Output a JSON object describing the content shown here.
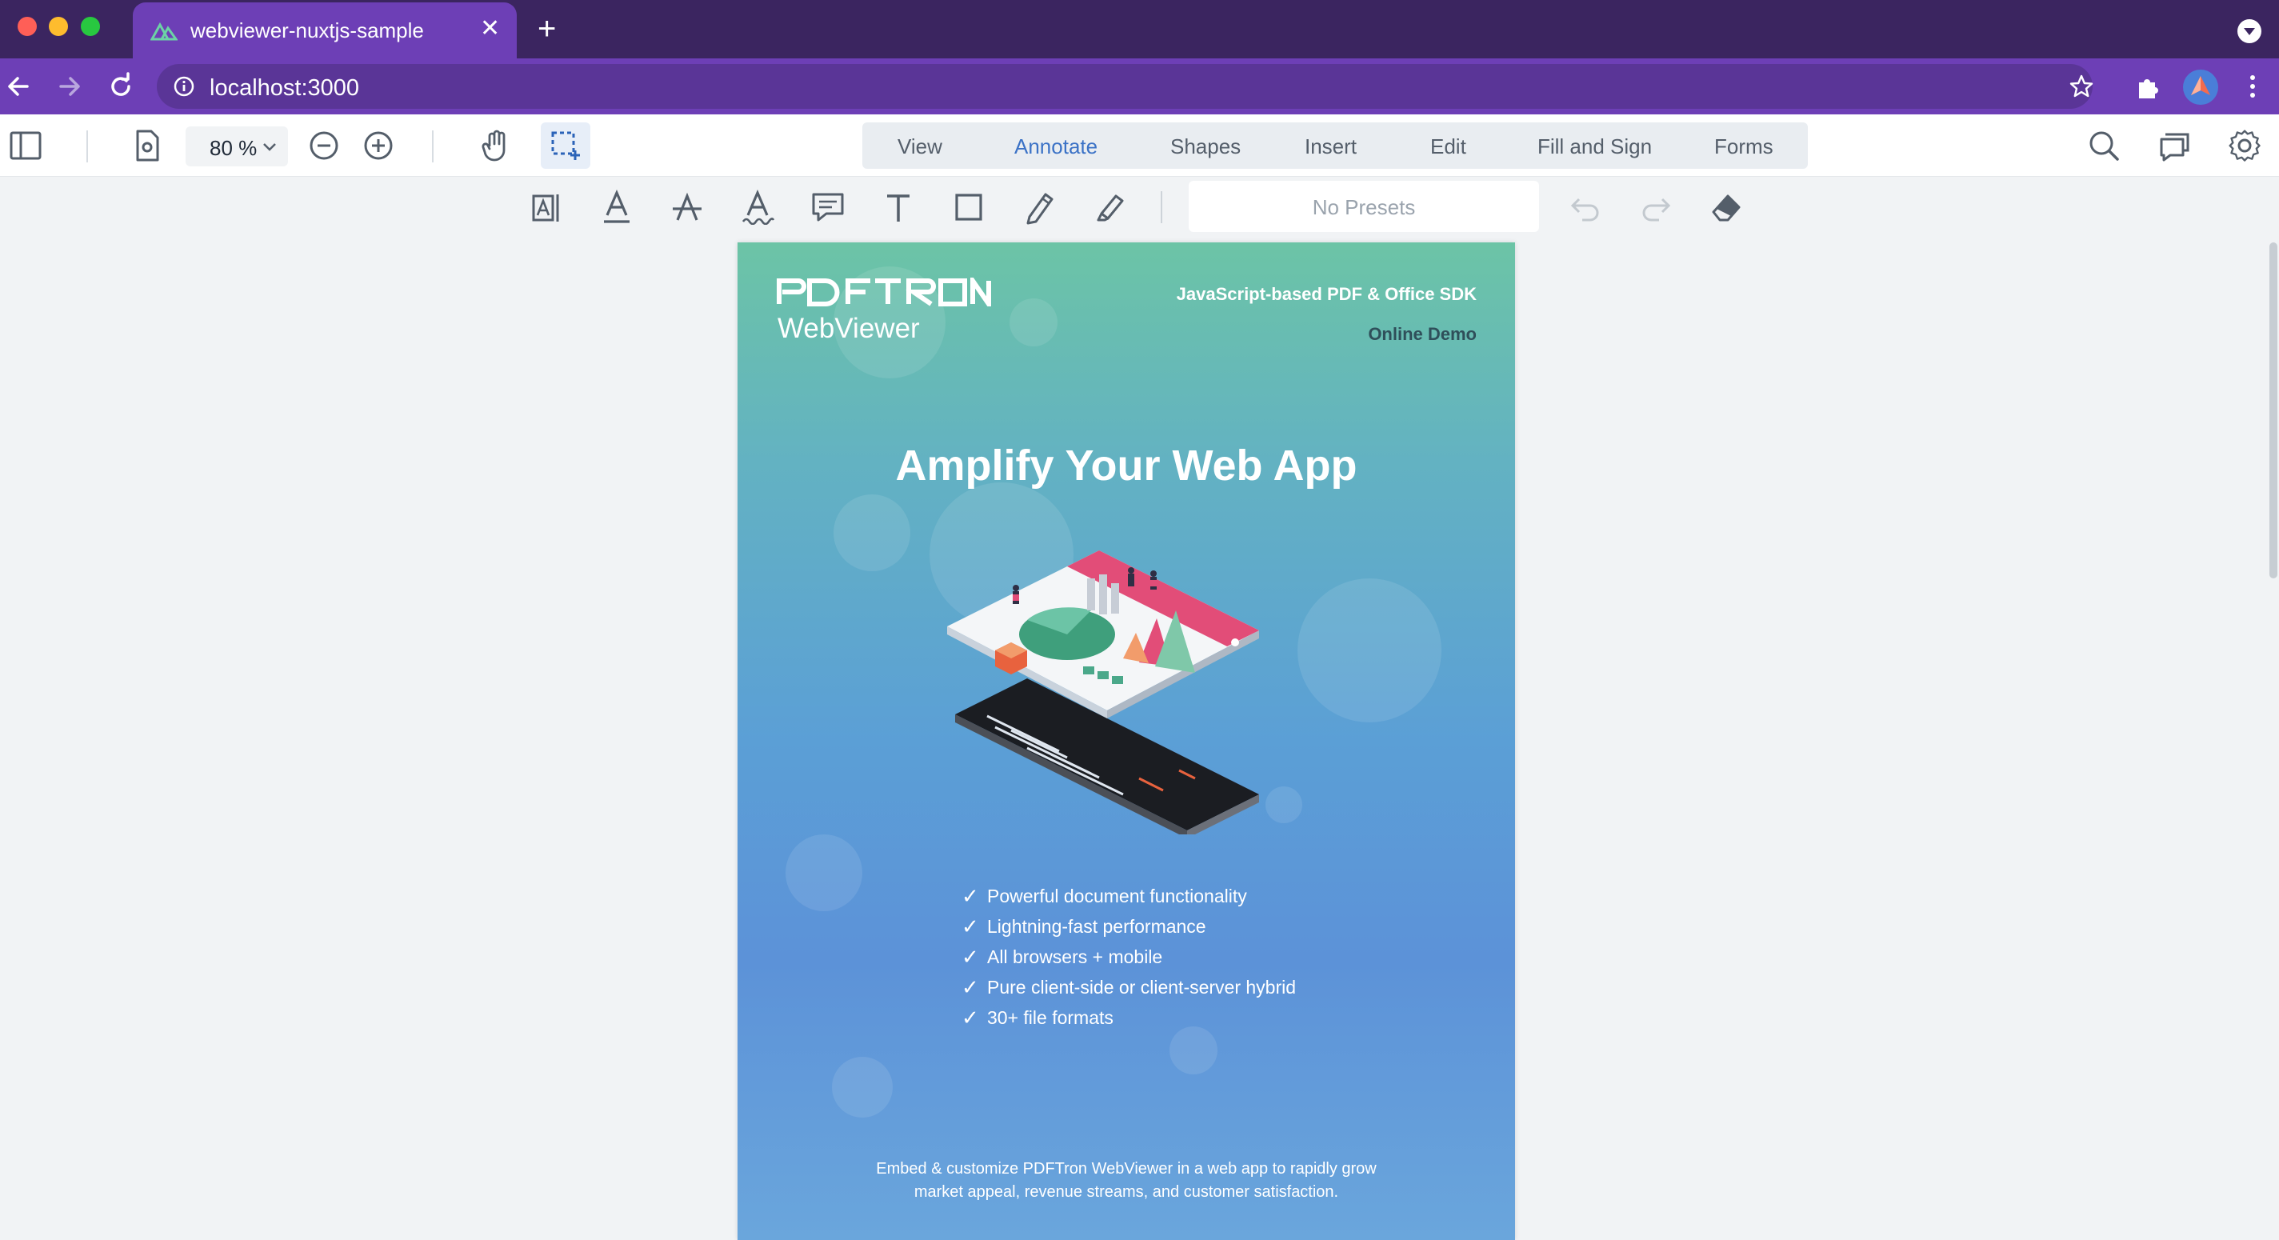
{
  "browser": {
    "tab_title": "webviewer-nuxtjs-sample",
    "url": "localhost:3000",
    "traffic_colors": [
      "#ff5f57",
      "#febc2e",
      "#28c840"
    ]
  },
  "toolbar": {
    "zoom": "80 %",
    "ribbons": [
      "View",
      "Annotate",
      "Shapes",
      "Insert",
      "Edit",
      "Fill and Sign",
      "Forms"
    ],
    "active_ribbon": "Annotate",
    "presets_label": "No Presets"
  },
  "document": {
    "logo_sub": "WebViewer",
    "sdk_line": "JavaScript-based PDF & Office SDK",
    "demo_line": "Online Demo",
    "headline": "Amplify Your Web App",
    "check_glyph": "✓",
    "features": [
      "Powerful document functionality",
      "Lightning-fast performance",
      "All browsers + mobile",
      "Pure client-side or client-server hybrid",
      "30+ file formats"
    ],
    "footer_line1": "Embed & customize PDFTron WebViewer in a web app to rapidly grow",
    "footer_line2": "market appeal, revenue streams, and customer satisfaction."
  },
  "icons": {
    "header_left": [
      "panel-toggle-icon",
      "page-settings-icon",
      "zoom-out-icon",
      "zoom-in-icon",
      "pan-tool-icon",
      "marquee-select-icon"
    ],
    "header_right": [
      "search-icon",
      "comments-icon",
      "settings-icon"
    ],
    "annotate_tools": [
      "text-select-icon",
      "underline-icon",
      "strikeout-icon",
      "squiggly-icon",
      "comment-icon",
      "free-text-icon",
      "rectangle-icon",
      "freehand-icon",
      "highlighter-pen-icon",
      "undo-icon",
      "redo-icon",
      "eraser-icon"
    ]
  },
  "colors": {
    "browser_tab_bar": "#3b2560",
    "browser_accent": "#6d3fb6",
    "active_ribbon": "#3b72c6"
  }
}
